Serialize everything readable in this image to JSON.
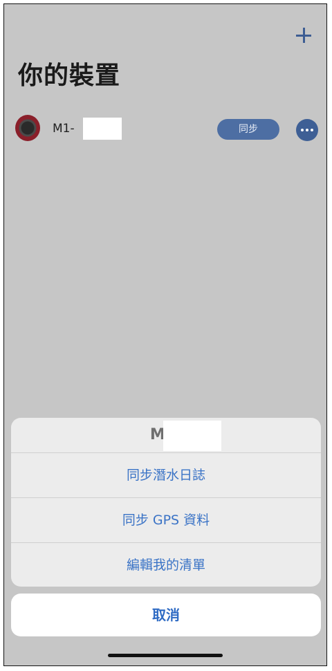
{
  "header": {
    "add_icon": "plus-icon",
    "title": "你的裝置"
  },
  "device": {
    "name": "M1-",
    "sync_label": "同步",
    "more_icon": "ellipsis-icon"
  },
  "action_sheet": {
    "title": "M1-",
    "items": [
      {
        "label": "同步潛水日誌"
      },
      {
        "label": "同步 GPS 資料"
      },
      {
        "label": "編輯我的清單"
      }
    ],
    "cancel_label": "取消"
  },
  "colors": {
    "accent": "#3a73c6",
    "button": "#4d6ea3",
    "backdrop": "#c6c6c6"
  }
}
